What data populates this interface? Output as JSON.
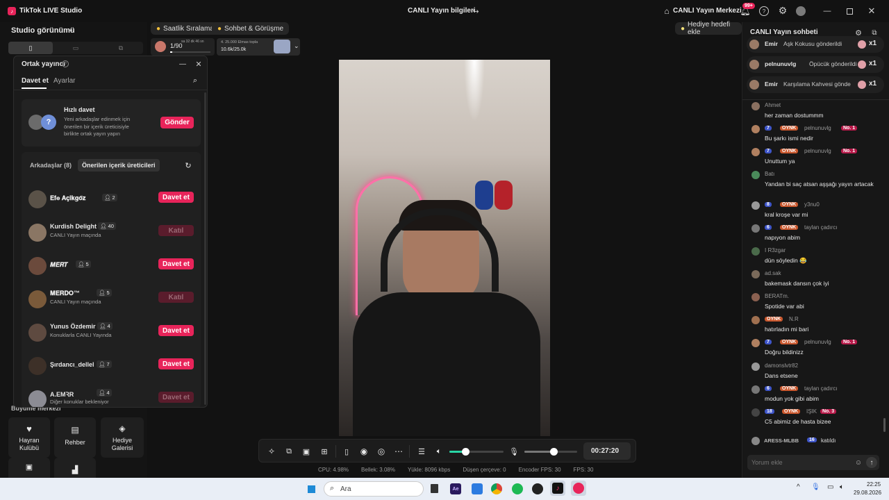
{
  "titlebar": {
    "app_name": "TikTok LIVE Studio",
    "center_title": "CANLI Yayın bilgileri",
    "live_center": "CANLI Yayın Merkezi",
    "notif_count": "99+"
  },
  "left": {
    "studio_view": "Studio görünümü",
    "growth_center": "Büyüme merkezi",
    "tools": [
      {
        "label": "Hayran Kulübü",
        "icon": "heart-icon"
      },
      {
        "label": "Rehber",
        "icon": "book-icon"
      },
      {
        "label": "Hediye Galerisi",
        "icon": "gift-icon"
      }
    ]
  },
  "topbar": {
    "hourly_rank": "Saatlik Sıralama",
    "chat_meet": "Sohbet & Görüşme",
    "goal_progress": "1/90",
    "goal_time": "sa 32 dk 46 sn",
    "diamonds_label": "4. 25.000 Elmas topla",
    "diamonds_value": "10.6k/25.0k",
    "gift_goal": "Hediye hedefi ekle"
  },
  "cohost": {
    "title": "Ortak yayıncı",
    "tabs": [
      "Davet et",
      "Ayarlar"
    ],
    "quick_title": "Hızlı davet",
    "quick_desc": "Yeni arkadaşlar edinmek için önerilen bir içerik üreticisiyle birlikte ortak yayın yapın",
    "send_label": "Gönder",
    "friends_tab": "Arkadaşlar (8)",
    "suggested_tab": "Önerilen içerik üreticileri",
    "creators": [
      {
        "name": "𝐄𝐟𝐞 𝐀𝐜̧𝐢𝐤𝐠𝐨̈𝐳",
        "count": "2",
        "sub": "",
        "action": "Davet et",
        "active": true
      },
      {
        "name": "Kurdish Delight",
        "count": "40",
        "sub": "CANLI Yayın maçında",
        "action": "Katıl",
        "active": false
      },
      {
        "name": "𝑴𝑬𝑹𝑻",
        "count": "5",
        "sub": "",
        "action": "Davet et",
        "active": true
      },
      {
        "name": "𝐌𝐄𝐑𝐃𝐎™",
        "count": "5",
        "sub": "CANLI Yayın maçında",
        "action": "Katıl",
        "active": false
      },
      {
        "name": "Yunus Özdemir",
        "count": "4",
        "sub": "Konuklarla CANLI Yayında",
        "action": "Davet et",
        "active": true
      },
      {
        "name": "Şırdancı_dellel",
        "count": "7",
        "sub": "",
        "action": "Davet et",
        "active": true
      },
      {
        "name": "A.EMꝚR",
        "count": "4",
        "sub": "Diğer konuklar bekleniyor",
        "action": "Davet et",
        "active": false
      }
    ]
  },
  "controls": {
    "timer": "00:27:20",
    "mic_level": 0.55,
    "volume_level": 0.3
  },
  "stats": {
    "cpu": "CPU:  4.98%",
    "mem": "Bellek:  3.08%",
    "upload": "Yükle:  8096 kbps",
    "dropped": "Düşen çerçeve:  0",
    "encoder": "Encoder FPS:  30",
    "fps": "FPS:  30"
  },
  "chat": {
    "title": "CANLI Yayın sohbeti",
    "input_placeholder": "Yorum ekle",
    "gifts": [
      {
        "user": "Emir",
        "text": "Aşk Kokusu gönderildi",
        "count": "x1"
      },
      {
        "user": "pelnunuvlg",
        "text": "Öpücük gönderildi",
        "count": "x1"
      },
      {
        "user": "Emir",
        "text": "Karşılama Kahvesi gönde",
        "count": "x1"
      }
    ],
    "messages": [
      {
        "user": "Ahmet",
        "lvl": "",
        "oy": "",
        "no": "",
        "text": "her zaman dostummm"
      },
      {
        "user": "pelnunuvlg",
        "lvl": "7",
        "oy": "OYNK",
        "no": "No. 1",
        "text": "Bu şarkı ismi nedir"
      },
      {
        "user": "pelnunuvlg",
        "lvl": "7",
        "oy": "OYNK",
        "no": "No. 1",
        "text": "Unuttum ya"
      },
      {
        "user": "Batı",
        "lvl": "",
        "oy": "",
        "no": "",
        "text": "Yandan bi saç atsan aşşağı yayın artacak"
      },
      {
        "user": "y3nu0",
        "lvl": "8",
        "oy": "OYNK",
        "no": "",
        "text": "kral kroşe var mi"
      },
      {
        "user": "taylan çadırcı",
        "lvl": "6",
        "oy": "OYNK",
        "no": "",
        "text": "napıyon abim"
      },
      {
        "user": "I R3zgar",
        "lvl": "",
        "oy": "",
        "no": "",
        "text": "dün söyledin 😂"
      },
      {
        "user": "ad.sak",
        "lvl": "",
        "oy": "",
        "no": "",
        "text": "bakemask dansın çok iyi"
      },
      {
        "user": "BERATm.",
        "lvl": "",
        "oy": "",
        "no": "",
        "text": "Spotide var abi"
      },
      {
        "user": "N.R",
        "lvl": "",
        "oy": "OYNK",
        "no": "",
        "text": "hatırladın mi bari"
      },
      {
        "user": "pelnunuvlg",
        "lvl": "7",
        "oy": "OYNK",
        "no": "No. 1",
        "text": "Doğru bildinizz"
      },
      {
        "user": "damonslvtr82",
        "lvl": "",
        "oy": "",
        "no": "",
        "text": "Dans etsene"
      },
      {
        "user": "taylan çadırcı",
        "lvl": "6",
        "oy": "OYNK",
        "no": "",
        "text": "modun yok gibi abim"
      },
      {
        "user": "IŞIK",
        "lvl": "18",
        "oy": "OYNK",
        "no": "No. 3",
        "text": "C5 abimiz de hasta bizee"
      }
    ],
    "joined_user": "ARESS-MLBB",
    "joined_lvl": "16",
    "joined_text": "katıldı"
  },
  "taskbar": {
    "search": "Ara",
    "time": "22:25",
    "date": "29.08.2026"
  }
}
